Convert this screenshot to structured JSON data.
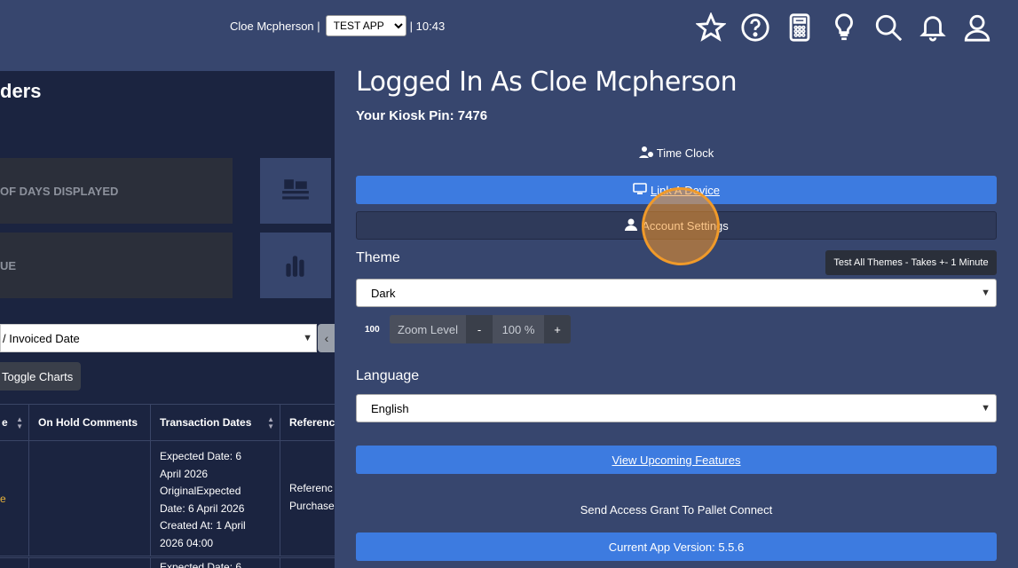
{
  "topbar": {
    "user_name": "Cloe Mcpherson |",
    "app_select": "TEST APP",
    "time": "| 10:43",
    "icons": [
      "star-icon",
      "help-icon",
      "calculator-icon",
      "lightbulb-icon",
      "search-icon",
      "bell-icon",
      "user-icon"
    ]
  },
  "left": {
    "page_title": "ders",
    "cards": [
      {
        "label": "OF DAYS DISPLAYED",
        "icon": "pallet-icon"
      },
      {
        "label": "UE",
        "icon": "bar-chart-icon"
      }
    ],
    "date_select": "/ Invoiced Date",
    "toggle_charts": "Toggle Charts",
    "table": {
      "headers": [
        "e",
        "On Hold Comments",
        "Transaction Dates",
        "Referenc"
      ],
      "row": {
        "col1": "e",
        "col2": "",
        "col3": [
          "Expected Date: 6",
          "April 2026",
          "OriginalExpected",
          "Date: 6 April 2026",
          "Created At: 1 April",
          "2026 04:00"
        ],
        "col4": [
          "Referenc",
          "Purchase"
        ]
      },
      "row2_partial": "Expected Date: 6"
    }
  },
  "panel": {
    "title": "Logged In As Cloe Mcpherson",
    "pin": "Your Kiosk Pin: 7476",
    "time_clock": "Time Clock",
    "link_device": "Link A Device",
    "account_settings": "Account Settings",
    "theme_label": "Theme",
    "test_themes": "Test All Themes - Takes +- 1 Minute",
    "theme_value": "Dark",
    "zoom": {
      "icon_text": "100",
      "label": "Zoom Level",
      "minus": "-",
      "value": "100 %",
      "plus": "+"
    },
    "language_label": "Language",
    "language_value": "English",
    "upcoming": "View Upcoming Features",
    "access_grant": "Send Access Grant To Pallet Connect",
    "version": "Current App Version: 5.5.6"
  }
}
